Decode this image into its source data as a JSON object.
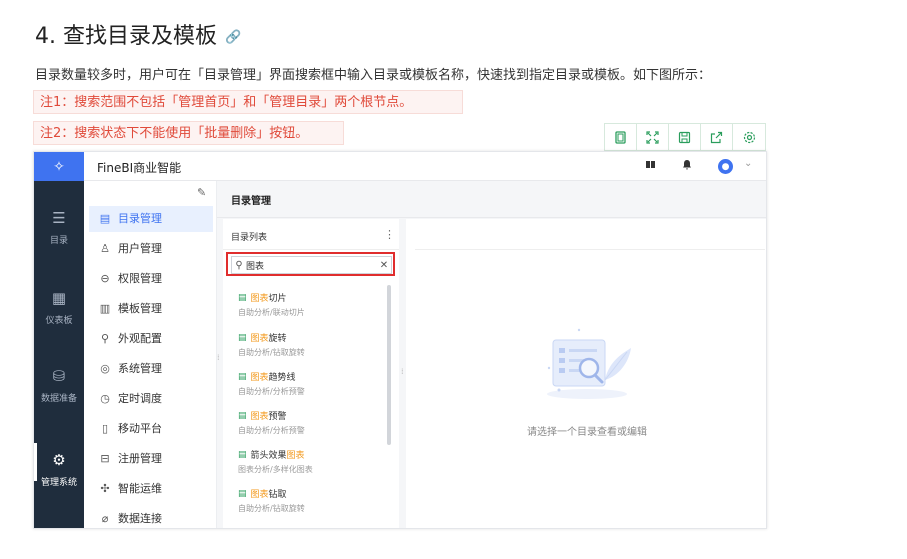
{
  "doc": {
    "title": "4. 查找目录及模板",
    "intro": "目录数量较多时，用户可在「目录管理」界面搜索框中输入目录或模板名称，快速找到指定目录或模板。如下图所示：",
    "note1": "注1：搜索范围不包括「管理首页」和「管理目录」两个根节点。",
    "note2": "注2：搜索状态下不能使用「批量删除」按钮。"
  },
  "toolbar_icons": [
    "copy-icon",
    "fullscreen-icon",
    "save-icon",
    "share-icon",
    "settings-icon"
  ],
  "app": {
    "name": "FineBI商业智能",
    "leftnav": [
      {
        "label": "目录",
        "icon": "list-icon"
      },
      {
        "label": "仪表板",
        "icon": "dashboard-icon"
      },
      {
        "label": "数据准备",
        "icon": "database-icon"
      },
      {
        "label": "管理系统",
        "icon": "gear-icon",
        "active": true
      }
    ],
    "menu": [
      {
        "label": "目录管理",
        "active": true
      },
      {
        "label": "用户管理"
      },
      {
        "label": "权限管理"
      },
      {
        "label": "模板管理"
      },
      {
        "label": "外观配置"
      },
      {
        "label": "系统管理"
      },
      {
        "label": "定时调度"
      },
      {
        "label": "移动平台"
      },
      {
        "label": "注册管理"
      },
      {
        "label": "智能运维"
      },
      {
        "label": "数据连接"
      }
    ],
    "content_title": "目录管理",
    "list_title": "目录列表",
    "search": {
      "value": "图表"
    },
    "results": [
      {
        "hl": "图表",
        "rest": "切片",
        "pre": "",
        "sub": "自助分析/联动切片"
      },
      {
        "hl": "图表",
        "rest": "旋转",
        "pre": "",
        "sub": "自助分析/钻取旋转"
      },
      {
        "hl": "图表",
        "rest": "趋势线",
        "pre": "",
        "sub": "自助分析/分析预警"
      },
      {
        "hl": "图表",
        "rest": "预警",
        "pre": "",
        "sub": "自助分析/分析预警"
      },
      {
        "hl": "图表",
        "rest": "",
        "pre": "箭头效果",
        "sub": "图表分析/多样化图表"
      },
      {
        "hl": "图表",
        "rest": "钻取",
        "pre": "",
        "sub": "自助分析/钻取旋转"
      }
    ],
    "empty_text": "请选择一个目录查看或编辑"
  },
  "colors": {
    "accent": "#3f73f0",
    "nav_bg": "#1f2d3d",
    "highlight": "#f39a1e",
    "note": "#e04a3a",
    "file_icon": "#2a9d5c"
  }
}
